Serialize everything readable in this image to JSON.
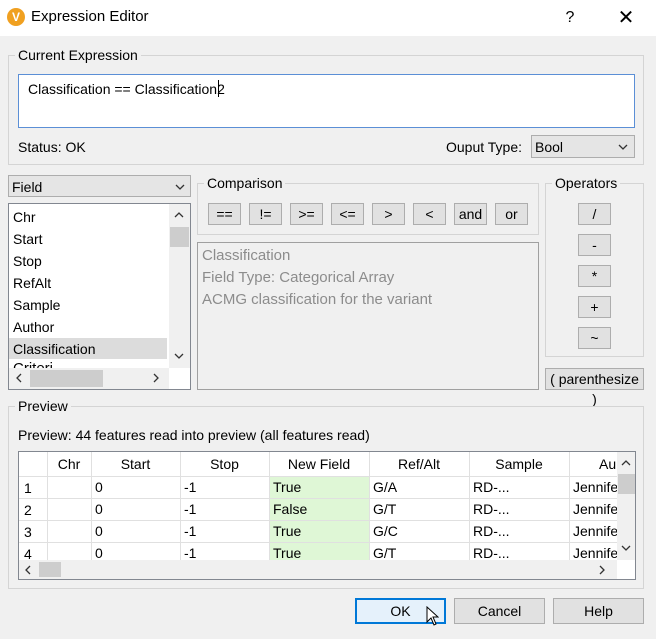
{
  "window": {
    "app_icon": "v-logo-icon",
    "title": "Expression Editor",
    "help_glyph": "?",
    "close_glyph": "✕"
  },
  "current_expression": {
    "group_label": "Current Expression",
    "value": "Classification ==  Classification2",
    "status": "Status: OK",
    "output_type_label": "Ouput Type:",
    "output_type_value": "Bool"
  },
  "field_panel": {
    "selector_value": "Field",
    "items": [
      "Chr",
      "Start",
      "Stop",
      "RefAlt",
      "Sample",
      "Author",
      "Classification",
      "Criteri..."
    ],
    "selected_item": "Classification"
  },
  "comparison": {
    "group_label": "Comparison",
    "buttons": [
      "==",
      "!=",
      ">=",
      "<=",
      ">",
      "<",
      "and",
      "or"
    ],
    "info_lines": [
      "Classification",
      "Field Type: Categorical Array",
      "ACMG classification for the variant"
    ]
  },
  "operators": {
    "group_label": "Operators",
    "buttons": [
      "/",
      "-",
      "*",
      "+",
      "~"
    ],
    "parenthesize_label": "( parenthesize )"
  },
  "preview": {
    "group_label": "Preview",
    "summary": "Preview: 44 features read into preview (all features read)",
    "columns": [
      "",
      "Chr",
      "Start",
      "Stop",
      "New Field",
      "Ref/Alt",
      "Sample",
      "Au"
    ],
    "rows": [
      [
        "1",
        "",
        "0",
        "-1",
        "True",
        "G/A",
        "RD-...",
        "Jennife"
      ],
      [
        "2",
        "",
        "0",
        "-1",
        "False",
        "G/T",
        "RD-...",
        "Jennife"
      ],
      [
        "3",
        "",
        "0",
        "-1",
        "True",
        "G/C",
        "RD-...",
        "Jennife"
      ],
      [
        "4",
        "",
        "0",
        "-1",
        "True",
        "G/T",
        "RD-...",
        "Jennife"
      ]
    ]
  },
  "footer": {
    "ok_label": "OK",
    "cancel_label": "Cancel",
    "help_label": "Help"
  }
}
